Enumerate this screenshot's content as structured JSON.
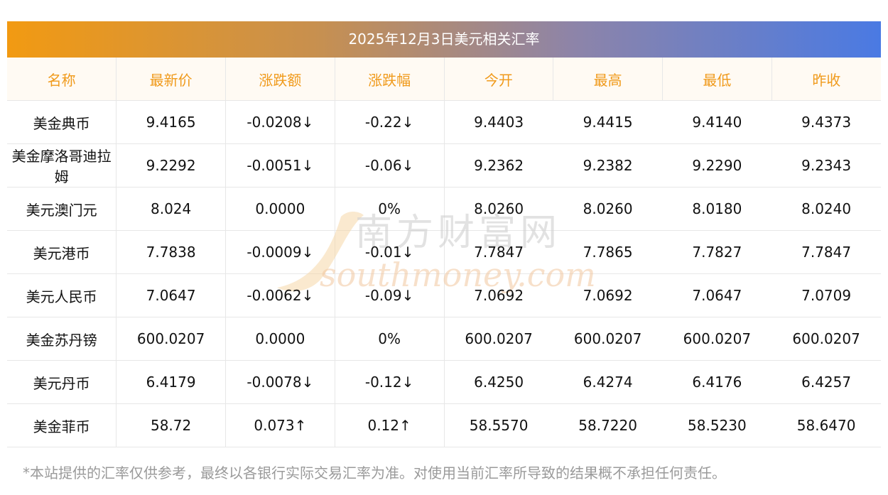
{
  "title": "2025年12月3日美元相关汇率",
  "columns": [
    "名称",
    "最新价",
    "涨跌额",
    "涨跌幅",
    "今开",
    "最高",
    "最低",
    "昨收"
  ],
  "rows": [
    {
      "name": "美金典币",
      "latest": "9.4165",
      "change": "-0.0208↓",
      "pct": "-0.22↓",
      "open": "9.4403",
      "high": "9.4415",
      "low": "9.4140",
      "prev": "9.4373",
      "dir": "down"
    },
    {
      "name": "美金摩洛哥迪拉姆",
      "latest": "9.2292",
      "change": "-0.0051↓",
      "pct": "-0.06↓",
      "open": "9.2362",
      "high": "9.2382",
      "low": "9.2290",
      "prev": "9.2343",
      "dir": "down"
    },
    {
      "name": "美元澳门元",
      "latest": "8.024",
      "change": "0.0000",
      "pct": "0%",
      "open": "8.0260",
      "high": "8.0260",
      "low": "8.0180",
      "prev": "8.0240",
      "dir": "flat"
    },
    {
      "name": "美元港币",
      "latest": "7.7838",
      "change": "-0.0009↓",
      "pct": "-0.01↓",
      "open": "7.7847",
      "high": "7.7865",
      "low": "7.7827",
      "prev": "7.7847",
      "dir": "down"
    },
    {
      "name": "美元人民币",
      "latest": "7.0647",
      "change": "-0.0062↓",
      "pct": "-0.09↓",
      "open": "7.0692",
      "high": "7.0692",
      "low": "7.0647",
      "prev": "7.0709",
      "dir": "down"
    },
    {
      "name": "美金苏丹镑",
      "latest": "600.0207",
      "change": "0.0000",
      "pct": "0%",
      "open": "600.0207",
      "high": "600.0207",
      "low": "600.0207",
      "prev": "600.0207",
      "dir": "flat"
    },
    {
      "name": "美元丹币",
      "latest": "6.4179",
      "change": "-0.0078↓",
      "pct": "-0.12↓",
      "open": "6.4250",
      "high": "6.4274",
      "low": "6.4176",
      "prev": "6.4257",
      "dir": "down"
    },
    {
      "name": "美金菲币",
      "latest": "58.72",
      "change": "0.073↑",
      "pct": "0.12↑",
      "open": "58.5570",
      "high": "58.7220",
      "low": "58.5230",
      "prev": "58.6470",
      "dir": "up"
    }
  ],
  "footnote": "*本站提供的汇率仅供参考，最终以各银行实际交易汇率为准。对使用当前汇率所导致的结果概不承担任何责任。",
  "watermark": {
    "cn": "南方财富网",
    "en": "southmoney.com"
  },
  "colors": {
    "down": "#1f8f1f",
    "up": "#ea1414",
    "header_text": "#f09a1b",
    "header_bg": "#fffaf3"
  }
}
